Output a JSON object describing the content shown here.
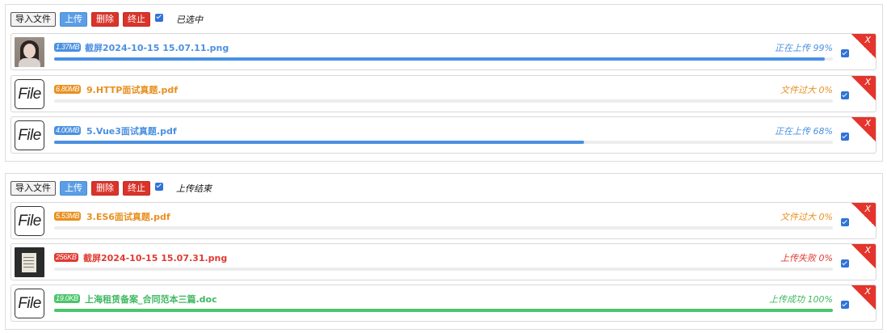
{
  "panels": [
    {
      "toolbar": {
        "import_label": "导入文件",
        "upload_label": "上传",
        "delete_label": "删除",
        "stop_label": "终止",
        "status": "已选中"
      },
      "files": [
        {
          "thumb": "photo",
          "size": "1.37MB",
          "name": "截屏2024-10-15 15.07.11.png",
          "state": "正在上传 99%",
          "progress": 0.99,
          "color": "#4a90e2",
          "close": "X"
        },
        {
          "thumb": "File",
          "size": "6.80MB",
          "name": "9.HTTP面试真题.pdf",
          "state": "文件过大 0%",
          "progress": 0,
          "color": "#e8901f",
          "close": "X"
        },
        {
          "thumb": "File",
          "size": "4.00MB",
          "name": "5.Vue3面试真题.pdf",
          "state": "正在上传 68%",
          "progress": 0.68,
          "color": "#4a90e2",
          "close": "X"
        }
      ]
    },
    {
      "toolbar": {
        "import_label": "导入文件",
        "upload_label": "上传",
        "delete_label": "删除",
        "stop_label": "终止",
        "status": "上传结束"
      },
      "files": [
        {
          "thumb": "File",
          "size": "5.53MB",
          "name": "3.ES6面试真题.pdf",
          "state": "文件过大 0%",
          "progress": 0,
          "color": "#e8901f",
          "close": "X"
        },
        {
          "thumb": "screenshot",
          "size": "256KB",
          "name": "截屏2024-10-15 15.07.31.png",
          "state": "上传失败 0%",
          "progress": 0,
          "color": "#e03a2f",
          "close": "X"
        },
        {
          "thumb": "File",
          "size": "19.0KB",
          "name": "上海租赁备案_合同范本三篇.doc",
          "state": "上传成功 100%",
          "progress": 1.0,
          "color": "#4cc56b",
          "close": "X"
        }
      ]
    }
  ]
}
